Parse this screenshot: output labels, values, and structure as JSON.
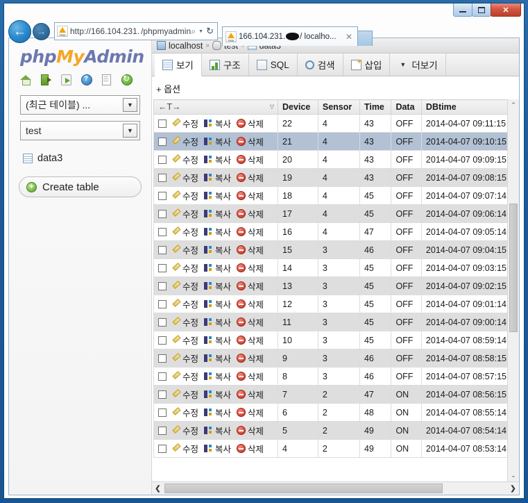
{
  "browser": {
    "caption": {
      "minimize": "–",
      "maximize": "□",
      "close": "✕"
    },
    "back_glyph": "←",
    "forward_glyph": "→",
    "address": {
      "prefix": "http://166.104.231.",
      "suffix": "/phpmyadmin/i"
    },
    "address_icons": {
      "search": "⌕",
      "caret": "▼",
      "reload": "↻"
    },
    "tab": {
      "prefix": "166.104.231.",
      "suffix": "/ localho...",
      "close": "✕"
    },
    "toolbar": {
      "home": "⌂",
      "favorites": "★",
      "settings": "⚙"
    }
  },
  "sidebar": {
    "logo": {
      "php": "php",
      "my": "My",
      "admin": "Admin"
    },
    "icons": [
      {
        "name": "home-icon",
        "title": "Home"
      },
      {
        "name": "logout-icon",
        "title": "Log out"
      },
      {
        "name": "export-icon",
        "title": "Export"
      },
      {
        "name": "help-icon",
        "title": "Help"
      },
      {
        "name": "docs-icon",
        "title": "Documentation"
      },
      {
        "name": "refresh-icon",
        "title": "Reload"
      }
    ],
    "recent_select": "(최근 테이블) ...",
    "database_select": "test",
    "table_item": "data3",
    "create_table": "Create table"
  },
  "breadcrumb": {
    "server": "localhost",
    "database": "test",
    "table": "data3",
    "separator": "»"
  },
  "tabs": [
    {
      "label": "보기",
      "icon": "browse-icon",
      "active": true
    },
    {
      "label": "구조",
      "icon": "structure-icon",
      "active": false
    },
    {
      "label": "SQL",
      "icon": "sql-icon",
      "active": false
    },
    {
      "label": "검색",
      "icon": "search-icon",
      "active": false
    },
    {
      "label": "삽입",
      "icon": "insert-icon",
      "active": false
    },
    {
      "label": "더보기",
      "icon": "chevron-down-icon",
      "active": false
    }
  ],
  "options_link": "+ 옵션",
  "table": {
    "sorter_label": "←T→",
    "sort_caret": "▽",
    "actions": {
      "edit": "수정",
      "copy": "복사",
      "delete": "삭제"
    },
    "columns": [
      "Device",
      "Sensor",
      "Time",
      "Data",
      "DBtime"
    ],
    "rows": [
      {
        "device": "22",
        "sensor": "4",
        "time": "43",
        "data": "OFF",
        "dbtime": "2014-04-07 09:11:15",
        "state": "odd"
      },
      {
        "device": "21",
        "sensor": "4",
        "time": "43",
        "data": "OFF",
        "dbtime": "2014-04-07 09:10:15",
        "state": "marked"
      },
      {
        "device": "20",
        "sensor": "4",
        "time": "43",
        "data": "OFF",
        "dbtime": "2014-04-07 09:09:15",
        "state": "odd"
      },
      {
        "device": "19",
        "sensor": "4",
        "time": "43",
        "data": "OFF",
        "dbtime": "2014-04-07 09:08:15",
        "state": "even"
      },
      {
        "device": "18",
        "sensor": "4",
        "time": "45",
        "data": "OFF",
        "dbtime": "2014-04-07 09:07:14",
        "state": "odd"
      },
      {
        "device": "17",
        "sensor": "4",
        "time": "45",
        "data": "OFF",
        "dbtime": "2014-04-07 09:06:14",
        "state": "even"
      },
      {
        "device": "16",
        "sensor": "4",
        "time": "47",
        "data": "OFF",
        "dbtime": "2014-04-07 09:05:14",
        "state": "odd"
      },
      {
        "device": "15",
        "sensor": "3",
        "time": "46",
        "data": "OFF",
        "dbtime": "2014-04-07 09:04:15",
        "state": "even"
      },
      {
        "device": "14",
        "sensor": "3",
        "time": "45",
        "data": "OFF",
        "dbtime": "2014-04-07 09:03:15",
        "state": "odd"
      },
      {
        "device": "13",
        "sensor": "3",
        "time": "45",
        "data": "OFF",
        "dbtime": "2014-04-07 09:02:15",
        "state": "even"
      },
      {
        "device": "12",
        "sensor": "3",
        "time": "45",
        "data": "OFF",
        "dbtime": "2014-04-07 09:01:14",
        "state": "odd"
      },
      {
        "device": "11",
        "sensor": "3",
        "time": "45",
        "data": "OFF",
        "dbtime": "2014-04-07 09:00:14",
        "state": "even"
      },
      {
        "device": "10",
        "sensor": "3",
        "time": "45",
        "data": "OFF",
        "dbtime": "2014-04-07 08:59:14",
        "state": "odd"
      },
      {
        "device": "9",
        "sensor": "3",
        "time": "46",
        "data": "OFF",
        "dbtime": "2014-04-07 08:58:15",
        "state": "even"
      },
      {
        "device": "8",
        "sensor": "3",
        "time": "46",
        "data": "OFF",
        "dbtime": "2014-04-07 08:57:15",
        "state": "odd"
      },
      {
        "device": "7",
        "sensor": "2",
        "time": "47",
        "data": "ON",
        "dbtime": "2014-04-07 08:56:15",
        "state": "even"
      },
      {
        "device": "6",
        "sensor": "2",
        "time": "48",
        "data": "ON",
        "dbtime": "2014-04-07 08:55:14",
        "state": "odd"
      },
      {
        "device": "5",
        "sensor": "2",
        "time": "49",
        "data": "ON",
        "dbtime": "2014-04-07 08:54:14",
        "state": "even"
      },
      {
        "device": "4",
        "sensor": "2",
        "time": "49",
        "data": "ON",
        "dbtime": "2014-04-07 08:53:14",
        "state": "odd"
      }
    ]
  },
  "scrollbars": {
    "v_up": "⌃",
    "v_down": "⌄",
    "h_left": "❮",
    "h_right": "❯"
  },
  "colors": {
    "accent_blue": "#1d5a97",
    "logo_purple": "#6c78af",
    "logo_orange": "#f5a623",
    "marked_row": "#b2c1d4"
  }
}
